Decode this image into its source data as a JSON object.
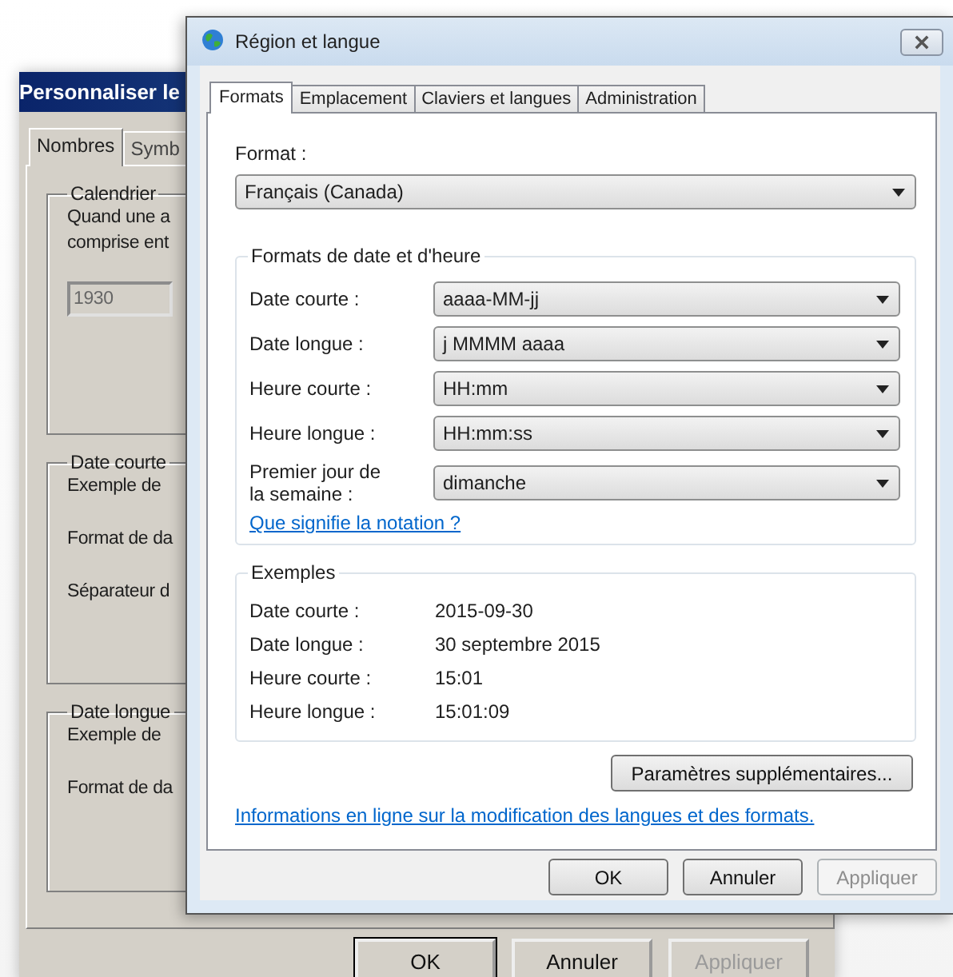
{
  "back_window": {
    "title": "Personnaliser le",
    "tabs": [
      {
        "label": "Nombres",
        "selected": true
      },
      {
        "label": "Symb",
        "selected": false
      }
    ],
    "calendar": {
      "title": "Calendrier",
      "lines": [
        "Quand une a",
        "comprise ent"
      ],
      "field": {
        "value": "1930",
        "disabled": true
      }
    },
    "short_date": {
      "title": "Date courte",
      "example_label": "Exemple de",
      "field_labels": [
        "Format de da",
        "Séparateur d"
      ]
    },
    "long_date": {
      "title": "Date longue",
      "example_label": "Exemple de",
      "field_labels": [
        "Format de da"
      ]
    },
    "buttons": [
      {
        "label": "OK",
        "disabled": false,
        "default": true
      },
      {
        "label": "Annuler",
        "disabled": false,
        "default": false
      },
      {
        "label": "Appliquer",
        "disabled": true,
        "default": false
      }
    ]
  },
  "window": {
    "title": "Région et langue"
  },
  "tabs": [
    {
      "label": "Formats",
      "selected": true
    },
    {
      "label": "Emplacement",
      "selected": false
    },
    {
      "label": "Claviers et langues",
      "selected": false
    },
    {
      "label": "Administration",
      "selected": false
    }
  ],
  "format": {
    "label": "Format :",
    "value": "Français (Canada)"
  },
  "date_time_formats": {
    "title": "Formats de date et d'heure",
    "rows": [
      {
        "label": "Date courte :",
        "value": "aaaa-MM-jj"
      },
      {
        "label": "Date longue :",
        "value": "j MMMM aaaa"
      },
      {
        "label": "Heure courte :",
        "value": "HH:mm"
      },
      {
        "label": "Heure longue :",
        "value": "HH:mm:ss"
      },
      {
        "label": "Premier jour de la semaine :",
        "value": "dimanche"
      }
    ],
    "link": "Que signifie la notation ?"
  },
  "examples": {
    "title": "Exemples",
    "rows": [
      {
        "label": "Date courte :",
        "value": "2015-09-30"
      },
      {
        "label": "Date longue :",
        "value": "30 septembre 2015"
      },
      {
        "label": "Heure courte :",
        "value": "15:01"
      },
      {
        "label": "Heure longue :",
        "value": "15:01:09"
      }
    ]
  },
  "more_settings_button": "Paramètres supplémentaires...",
  "info_link": "Informations en ligne sur la modification des langues et des formats.",
  "buttons": [
    {
      "label": "OK",
      "disabled": false
    },
    {
      "label": "Annuler",
      "disabled": false
    },
    {
      "label": "Appliquer",
      "disabled": true
    }
  ]
}
